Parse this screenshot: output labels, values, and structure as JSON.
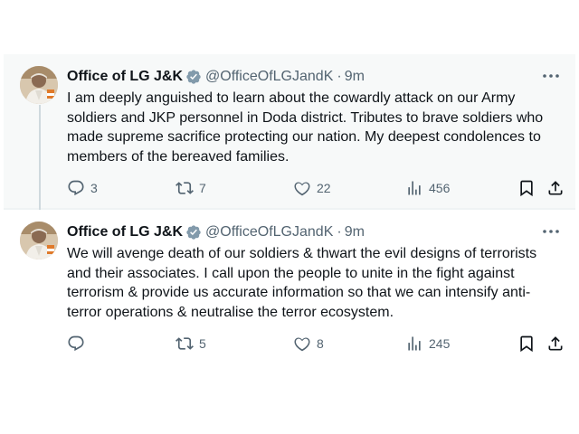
{
  "tweets": [
    {
      "author_name": "Office of LG J&K",
      "handle": "@OfficeOfLGJandK",
      "separator": "·",
      "time": "9m",
      "text": "I am deeply anguished to learn about the cowardly attack on our Army\nsoldiers and JKP personnel in Doda district. Tributes to brave soldiers who\nmade supreme sacrifice protecting our nation. My deepest condolences to\nmembers of the bereaved families.",
      "replies": "3",
      "reposts": "7",
      "likes": "22",
      "views": "456"
    },
    {
      "author_name": "Office of LG J&K",
      "handle": "@OfficeOfLGJandK",
      "separator": "·",
      "time": "9m",
      "text": "We will avenge death of our soldiers & thwart the evil designs of terrorists\nand their associates. I call upon the people to unite in the fight against\nterrorism & provide us accurate information so that we can intensify anti-\nterror operations & neutralise the terror ecosystem.",
      "replies": "",
      "reposts": "5",
      "likes": "8",
      "views": "245"
    }
  ],
  "icons": {
    "reply": "reply-icon",
    "repost": "repost-icon",
    "like": "like-icon",
    "views": "views-icon",
    "bookmark": "bookmark-icon",
    "share": "share-icon",
    "verified": "verified-badge-icon",
    "more": "more-options-icon"
  },
  "colors": {
    "text_primary": "#0f1419",
    "text_secondary": "#536471",
    "verified_badge": "#829aab",
    "highlight_background": "#f7f9f9"
  }
}
